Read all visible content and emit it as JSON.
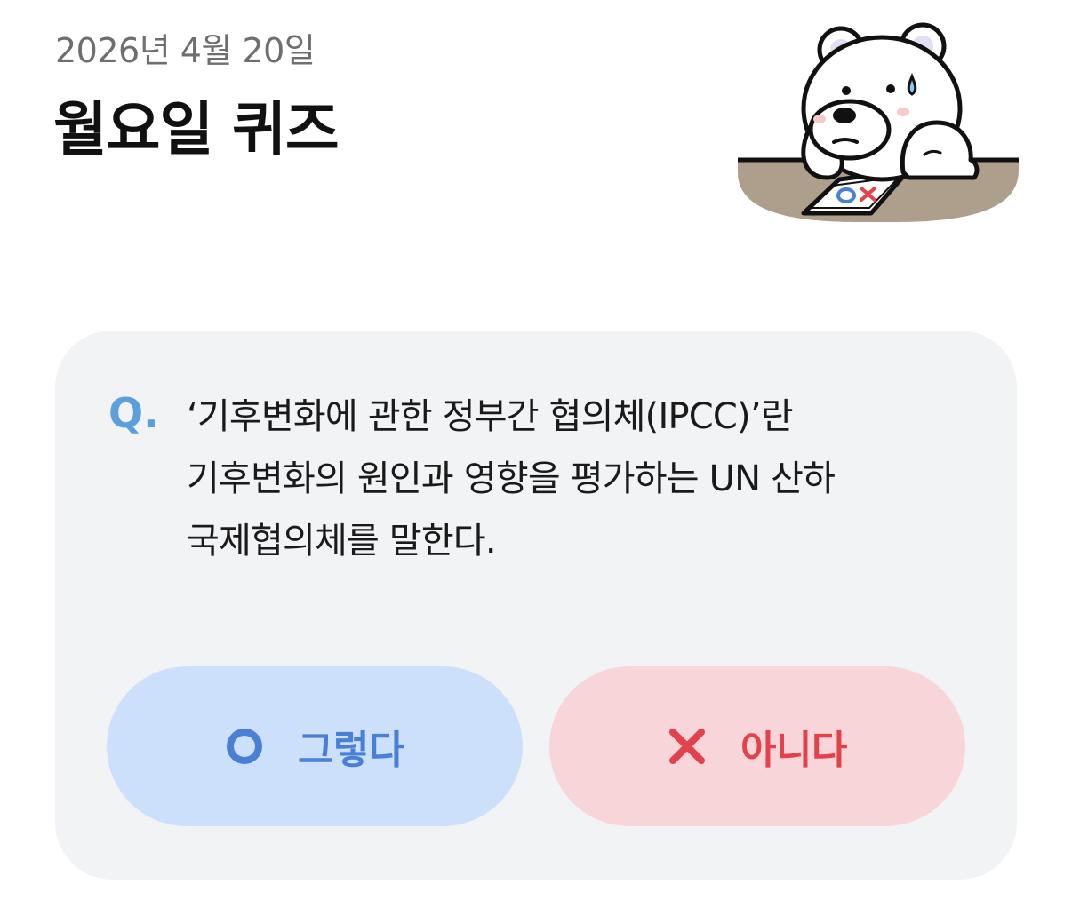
{
  "header": {
    "date": "2026년 4월 20일",
    "title": "월요일 퀴즈"
  },
  "mascot": {
    "description_icon": "polar-bear-mascot-icon",
    "paper_marks": "OX"
  },
  "quiz": {
    "q_label": "Q.",
    "question_lines": [
      "‘기후변화에 관한 정부간 협의체(IPCC)’란",
      "기후변화의 원인과 영향을 평가하는 UN 산하",
      "국제협의체를 말한다."
    ]
  },
  "answers": {
    "yes": {
      "label": "그렇다",
      "icon": "circle-o-icon",
      "color": "#4a7fd6"
    },
    "no": {
      "label": "아니다",
      "icon": "x-mark-icon",
      "color": "#e1424b"
    }
  },
  "colors": {
    "card_bg": "#f2f3f5",
    "yes_bg": "#cde0fb",
    "no_bg": "#f8d5d9",
    "accent_blue": "#5b9fdc"
  }
}
